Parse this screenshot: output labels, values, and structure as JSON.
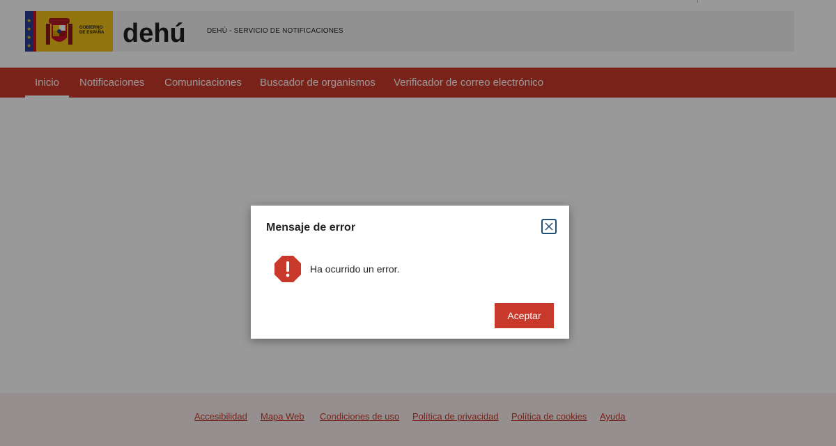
{
  "header": {
    "gov_logo_text": [
      "GOBIERNO",
      "DE ESPAÑA"
    ],
    "brand_logo_text": "dehú",
    "site_title": "DEHÚ - SERVICIO DE NOTIFICACIONES"
  },
  "nav": {
    "items": [
      {
        "label": "Inicio",
        "active": true
      },
      {
        "label": "Notificaciones",
        "active": false
      },
      {
        "label": "Comunicaciones",
        "active": false
      },
      {
        "label": "Buscador de organismos",
        "active": false
      },
      {
        "label": "Verificador de correo electrónico",
        "active": false
      }
    ]
  },
  "dialog": {
    "title": "Mensaje de error",
    "message": "Ha ocurrido un error.",
    "accept_label": "Aceptar",
    "close_icon": "close-icon",
    "status_icon": "error-octagon-icon"
  },
  "footer": {
    "links": [
      "Accesibilidad",
      "Mapa Web",
      "Condiciones de uso",
      "Política de privacidad",
      "Política de cookies",
      "Ayuda"
    ]
  },
  "colors": {
    "brand_red": "#c9392b",
    "gov_yellow": "#f3c318",
    "footer_bg": "#fbefef",
    "overlay": "rgba(0,0,0,0.40)"
  }
}
